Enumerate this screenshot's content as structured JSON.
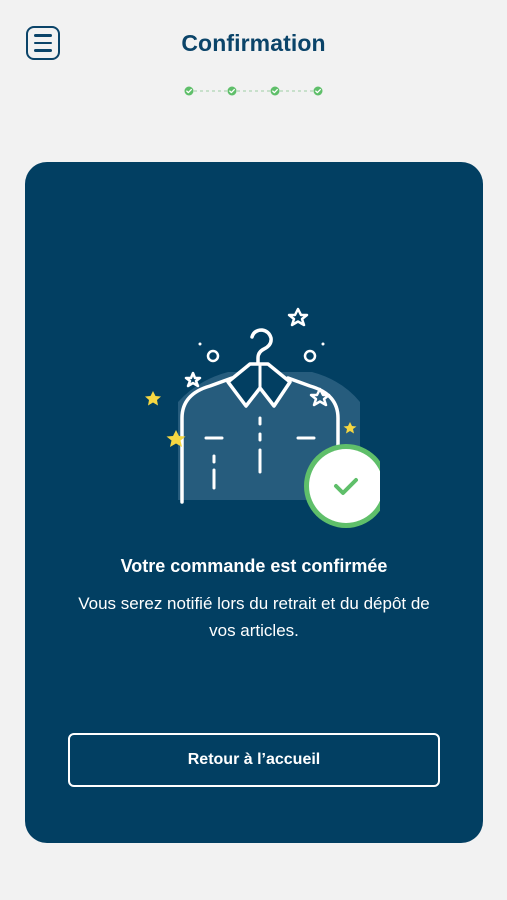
{
  "header": {
    "title": "Confirmation",
    "menu_icon": "menu-icon",
    "progress": {
      "steps_total": 4,
      "steps_completed": 4,
      "step_icon": "check-circle-icon",
      "color": "#5fbf6a"
    }
  },
  "confirmation": {
    "illustration_icon": "clothes-hanger-checkmark-illustration",
    "title": "Votre commande est confirmée",
    "message": "Vous serez notifié lors du retrait et du dépôt de vos articles.",
    "home_button_label": "Retour à l’accueil"
  },
  "colors": {
    "background": "#f2f2f2",
    "primary": "#023f62",
    "title_text": "#0b4469",
    "success": "#5fbf6a",
    "star": "#f5d742"
  }
}
